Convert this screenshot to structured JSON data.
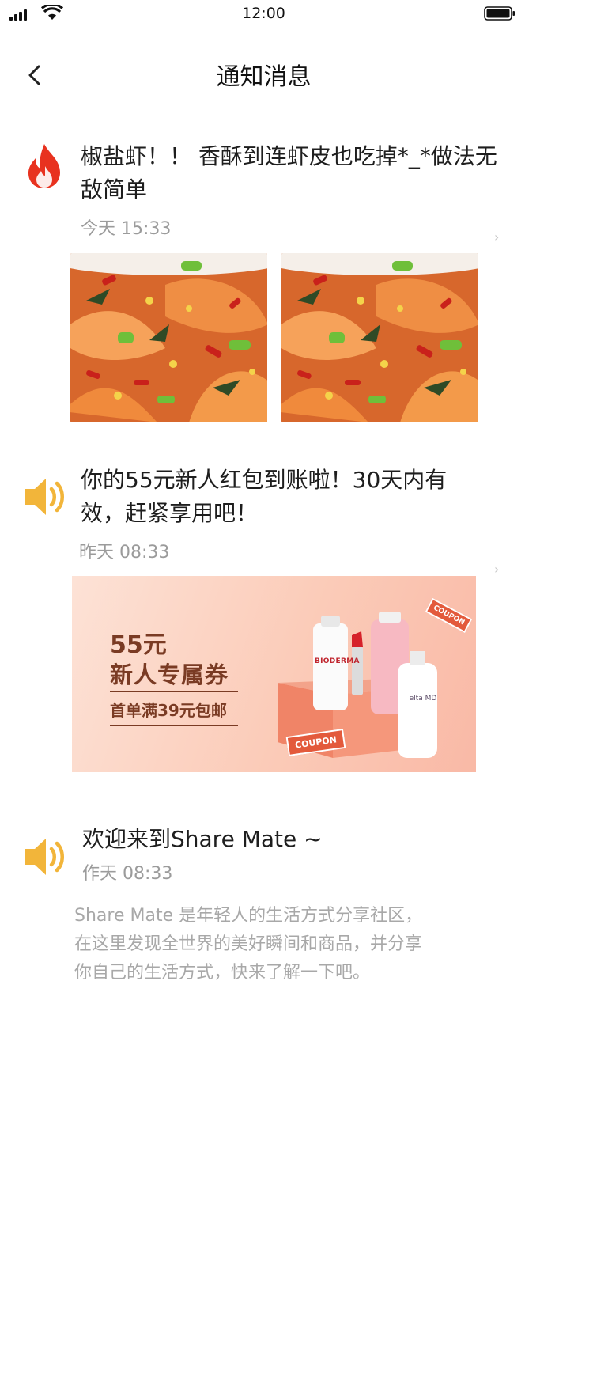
{
  "status_bar": {
    "time": "12:00"
  },
  "nav": {
    "title": "通知消息"
  },
  "notifications": [
    {
      "icon": "flame-icon",
      "title": "椒盐虾！！ 香酥到连虾皮也吃掉*_*做法无敌简单",
      "time": "今天   15:33"
    },
    {
      "icon": "speaker-icon",
      "title": "你的55元新人红包到账啦！30天内有效，赶紧享用吧！",
      "time": "昨天   08:33",
      "banner": {
        "amount": "55元",
        "headline": "新人专属券",
        "subline": "首单满39元包邮",
        "tag": "COUPON",
        "product_labels": [
          "BIODERMA",
          "elta MD"
        ]
      }
    },
    {
      "icon": "speaker-icon",
      "title": "欢迎来到Share Mate ~",
      "time": "作天   08:33",
      "body": "Share Mate 是年轻人的生活方式分享社区，在这里发现全世界的美好瞬间和商品，并分享你自己的生活方式，快来了解一下吧。"
    }
  ],
  "colors": {
    "flame": "#e8321f",
    "speaker": "#f2b53a",
    "banner_text": "#7a3b24",
    "muted_text": "#9b9b9b"
  }
}
